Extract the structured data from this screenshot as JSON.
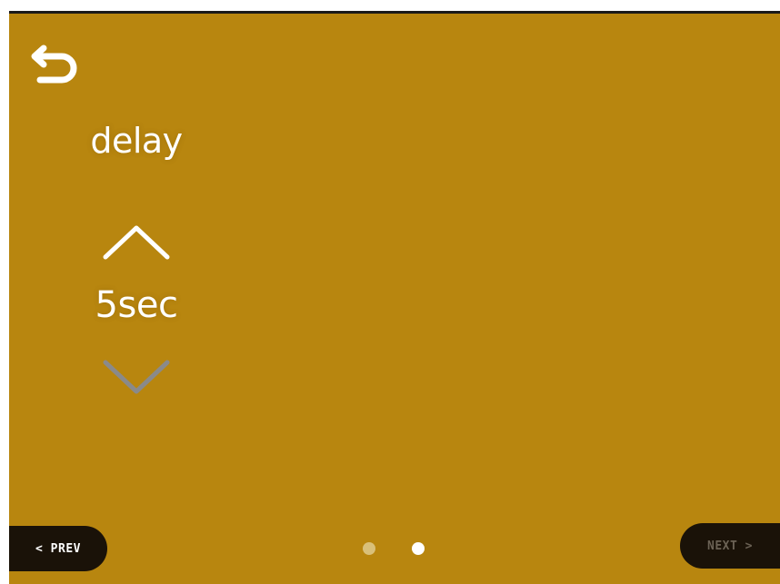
{
  "colors": {
    "background": "#b8860f",
    "text": "#ffffff",
    "nav_button_bg": "#1a1208",
    "next_disabled_text": "#6b6255",
    "dot_inactive": "#d9c07a",
    "dot_active": "#ffffff",
    "arrow_down": "#8a8a8a"
  },
  "header": {
    "back_icon": "undo-arrow-icon"
  },
  "setting": {
    "label": "delay",
    "value": "5sec",
    "up_icon": "chevron-up-icon",
    "down_icon": "chevron-down-icon"
  },
  "footer": {
    "prev_label": "< PREV",
    "next_label": "NEXT >",
    "next_enabled": false,
    "page_count": 2,
    "current_page": 2
  }
}
